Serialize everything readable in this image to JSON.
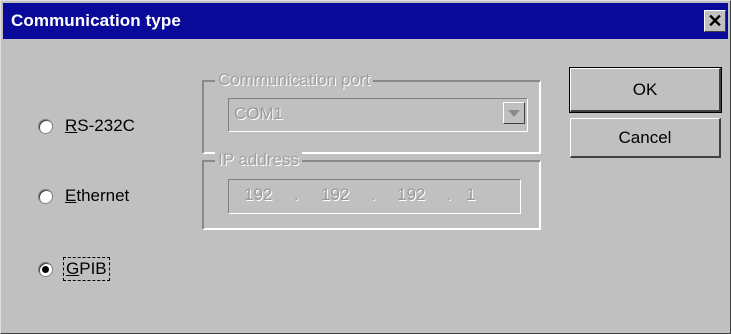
{
  "dialog": {
    "title": "Communication type",
    "close_glyph": "✕"
  },
  "options": [
    {
      "label": "RS-232C",
      "mnemonic": "R",
      "rest": "S-232C",
      "selected": false
    },
    {
      "label": "Ethernet",
      "mnemonic": "E",
      "rest": "thernet",
      "selected": false
    },
    {
      "label": "GPIB",
      "mnemonic": "G",
      "rest": "PIB",
      "selected": true
    }
  ],
  "com_group": {
    "title": "Communication port",
    "selected_value": "COM1"
  },
  "ip_group": {
    "title": "IP address",
    "octets": [
      "192",
      "192",
      "192",
      "1"
    ],
    "separator": "."
  },
  "buttons": {
    "ok": "OK",
    "cancel": "Cancel"
  }
}
